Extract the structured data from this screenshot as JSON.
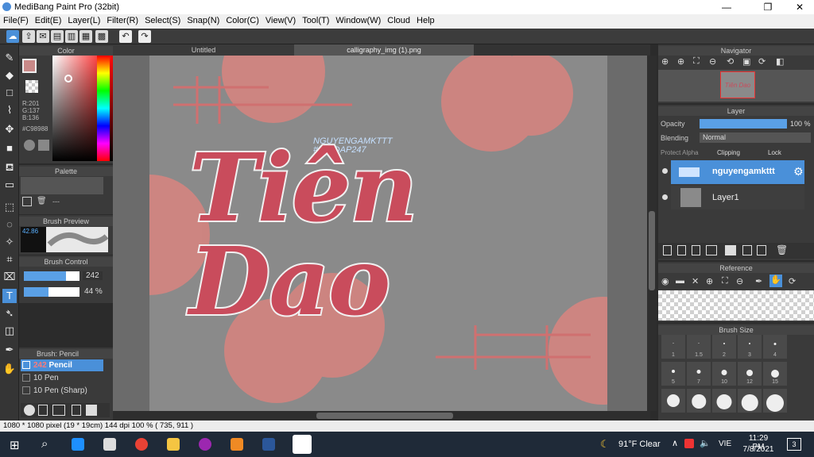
{
  "window": {
    "title": "MediBang Paint Pro (32bit)",
    "min": "—",
    "max": "❐",
    "close": "✕"
  },
  "menu": [
    "File(F)",
    "Edit(E)",
    "Layer(L)",
    "Filter(R)",
    "Select(S)",
    "Snap(N)",
    "Color(C)",
    "View(V)",
    "Tool(T)",
    "Window(W)",
    "Cloud",
    "Help"
  ],
  "tabs": {
    "tab1": "Untitled",
    "tab2": "calligraphy_img (1).png"
  },
  "color_panel": {
    "title": "Color",
    "r": "R:201",
    "g": "G:137",
    "b": "B:136",
    "hex": "#C98988",
    "current_color": "#c98988"
  },
  "palette": {
    "title": "Palette",
    "empty": "---"
  },
  "brush_preview": {
    "title": "Brush Preview",
    "size": "42.86"
  },
  "brush_control": {
    "title": "Brush Control",
    "size_value": "242",
    "opacity_value": "44 %",
    "size_frac": 0.76,
    "opacity_frac": 0.44
  },
  "brush_list": {
    "title": "Brush: Pencil",
    "items": [
      {
        "size": "242",
        "name": "Pencil"
      },
      {
        "size": "10",
        "name": "Pen"
      },
      {
        "size": "10",
        "name": "Pen (Sharp)"
      }
    ]
  },
  "navigator": {
    "title": "Navigator"
  },
  "layer_panel": {
    "title": "Layer",
    "opacity_label": "Opacity",
    "opacity_value": "100 %",
    "opacity_frac": 1.0,
    "blending_label": "Blending",
    "blending_value": "Normal",
    "protect_alpha": "Protect Alpha",
    "clipping": "Clipping",
    "lock": "Lock",
    "layers": [
      {
        "name": "nguyengamkttt"
      },
      {
        "name": "Layer1"
      }
    ]
  },
  "reference": {
    "title": "Reference"
  },
  "brush_size": {
    "title": "Brush Size",
    "sizes": [
      "1",
      "1.5",
      "2",
      "3",
      "4",
      "5",
      "7",
      "10",
      "12",
      "15"
    ]
  },
  "canvas": {
    "watermark1": "NGUYENGAMKTTT",
    "watermark2": "#HOIDAP247",
    "text": "Tiên Dao",
    "bg": "#8a8a8a",
    "text_color": "#c94c5c"
  },
  "status": "1080 * 1080 pixel   (19 * 19cm)   144 dpi   100 %   ( 735, 911 )",
  "taskbar": {
    "weather": "91°F  Clear",
    "lang": "VIE",
    "time": "11:29 PM",
    "date": "7/8/2021",
    "notif": "3"
  }
}
